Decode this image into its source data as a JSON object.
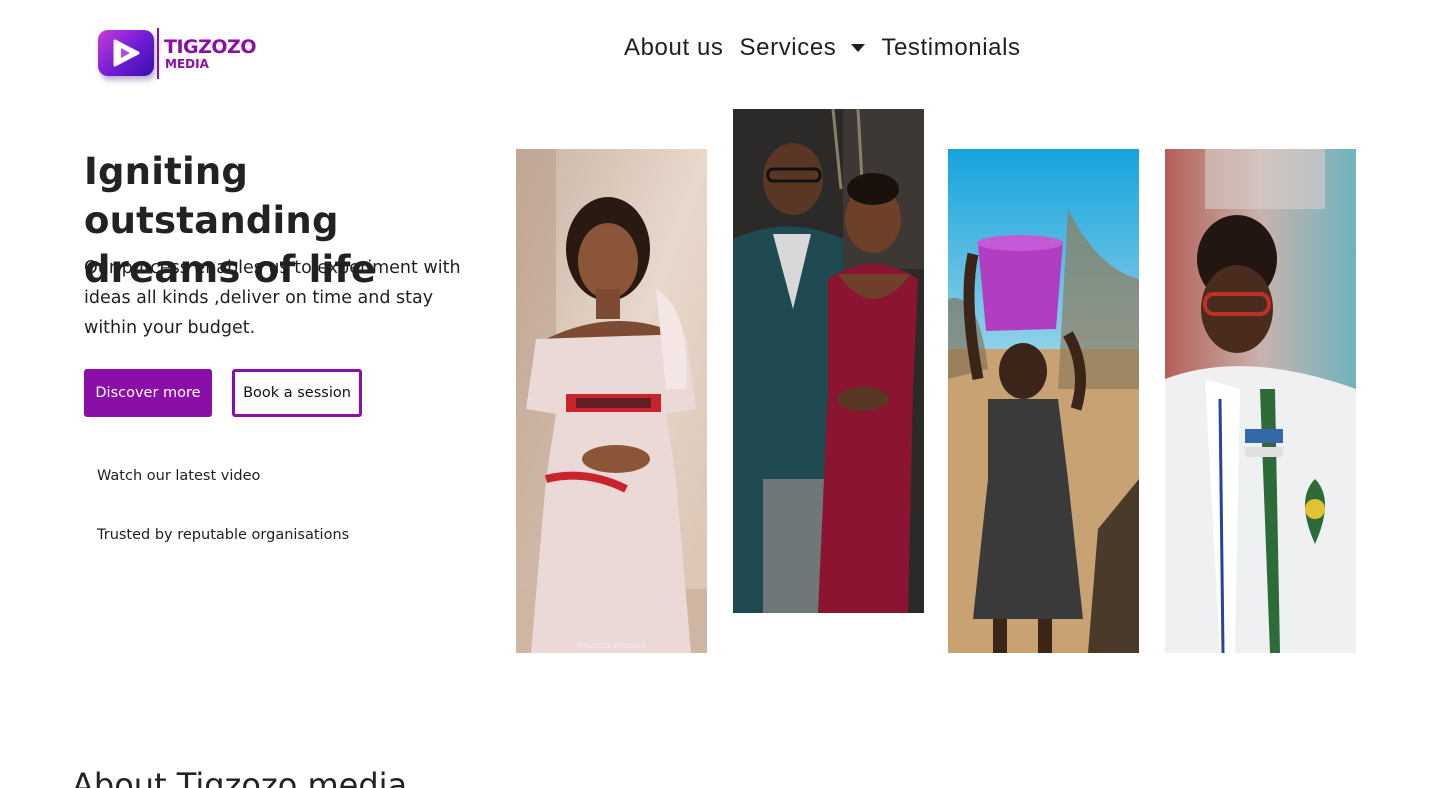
{
  "brand": {
    "name_line1": "TIGZOZO",
    "name_line2": "MEDIA",
    "accent_color": "#8a0fa8"
  },
  "nav": {
    "items": [
      {
        "label": "About us"
      },
      {
        "label": "Services",
        "has_dropdown": true
      },
      {
        "label": "Testimonials"
      }
    ]
  },
  "hero": {
    "title": "Igniting outstanding dreams of life",
    "subtitle": "Our process enables us to experiment with ideas all kinds ,deliver on time and stay within your budget.",
    "primary_button": "Discover more",
    "secondary_button": "Book a session",
    "video_link": "Watch our latest video",
    "trusted_link": "Trusted by reputable organisations"
  },
  "gallery": {
    "photos": [
      {
        "subject": "woman-in-pink-dress",
        "watermark": "TIGZOZO STUDIOS"
      },
      {
        "subject": "smiling-couple"
      },
      {
        "subject": "girl-carrying-bucket"
      },
      {
        "subject": "student-in-uniform"
      }
    ]
  },
  "about": {
    "title": "About Tigzozo media"
  }
}
